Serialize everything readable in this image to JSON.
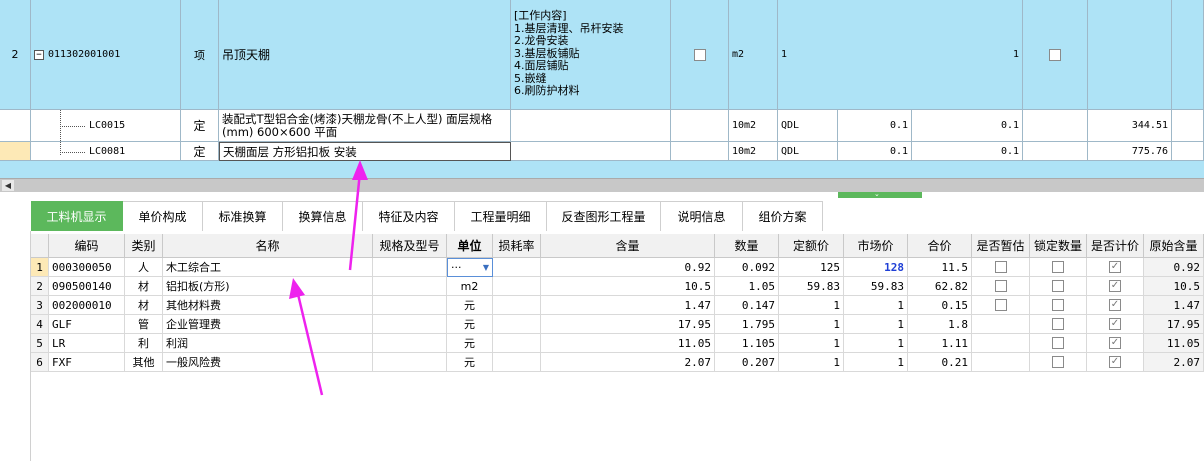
{
  "top_grid": {
    "row2": {
      "index": "2",
      "code": "011302001001",
      "type": "项",
      "name": "吊顶天棚",
      "work_content": [
        "[工作内容]",
        "1.基层清理、吊杆安装",
        "2.龙骨安装",
        "3.基层板铺贴",
        "4.面层铺贴",
        "5.嵌缝",
        "6.刷防护材料"
      ],
      "unit": "m2",
      "expr": "1",
      "qty": "1"
    },
    "sub_rows": [
      {
        "code": "LC0015",
        "type": "定",
        "name": "装配式T型铝合金(烤漆)天棚龙骨(不上人型) 面层规格(mm) 600×600 平面",
        "unit": "10m2",
        "expr": "QDL",
        "c1": "0.1",
        "c2": "0.1",
        "price": "344.51"
      },
      {
        "code": "LC0081",
        "type": "定",
        "name": "天棚面层 方形铝扣板 安装",
        "unit": "10m2",
        "expr": "QDL",
        "c1": "0.1",
        "c2": "0.1",
        "price": "775.76"
      }
    ]
  },
  "tabs": [
    "工料机显示",
    "单价构成",
    "标准换算",
    "换算信息",
    "特征及内容",
    "工程量明细",
    "反查图形工程量",
    "说明信息",
    "组价方案"
  ],
  "columns": [
    "编码",
    "类别",
    "名称",
    "规格及型号",
    "单位",
    "损耗率",
    "含量",
    "数量",
    "定额价",
    "市场价",
    "合价",
    "是否暂估",
    "锁定数量",
    "是否计价",
    "原始含量"
  ],
  "rows": [
    {
      "no": "1",
      "code": "000300050",
      "cat": "人",
      "name": "木工综合工",
      "unit": "···",
      "content": "0.92",
      "qty": "0.092",
      "quota": "125",
      "market": "128",
      "total": "11.5",
      "est": false,
      "lock": false,
      "priced": true,
      "orig": "0.92"
    },
    {
      "no": "2",
      "code": "090500140",
      "cat": "材",
      "name": "铝扣板(方形)",
      "unit": "m2",
      "content": "10.5",
      "qty": "1.05",
      "quota": "59.83",
      "market": "59.83",
      "total": "62.82",
      "est": false,
      "lock": false,
      "priced": true,
      "orig": "10.5"
    },
    {
      "no": "3",
      "code": "002000010",
      "cat": "材",
      "name": "其他材料费",
      "unit": "元",
      "content": "1.47",
      "qty": "0.147",
      "quota": "1",
      "market": "1",
      "total": "0.15",
      "est": false,
      "lock": false,
      "priced": true,
      "orig": "1.47"
    },
    {
      "no": "4",
      "code": "GLF",
      "cat": "管",
      "name": "企业管理费",
      "unit": "元",
      "content": "17.95",
      "qty": "1.795",
      "quota": "1",
      "market": "1",
      "total": "1.8",
      "est": null,
      "lock": false,
      "priced": true,
      "orig": "17.95"
    },
    {
      "no": "5",
      "code": "LR",
      "cat": "利",
      "name": "利润",
      "unit": "元",
      "content": "11.05",
      "qty": "1.105",
      "quota": "1",
      "market": "1",
      "total": "1.11",
      "est": null,
      "lock": false,
      "priced": true,
      "orig": "11.05"
    },
    {
      "no": "6",
      "code": "FXF",
      "cat": "其他",
      "name": "一般风险费",
      "unit": "元",
      "content": "2.07",
      "qty": "0.207",
      "quota": "1",
      "market": "1",
      "total": "0.21",
      "est": null,
      "lock": false,
      "priced": true,
      "orig": "2.07"
    }
  ],
  "colors": {
    "row_blue": "#aee3f6",
    "tab_active": "#5cb85c",
    "arrow": "#ee22ee",
    "market_blue": "#1f3fd6"
  }
}
